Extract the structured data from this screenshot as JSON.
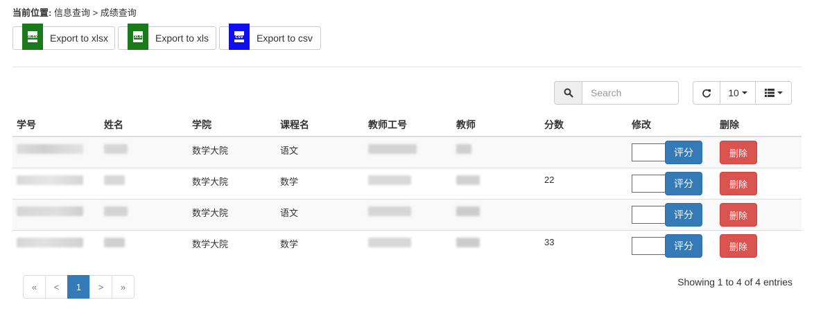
{
  "breadcrumb": {
    "label": "当前位置:",
    "path": "信息查询 > 成绩查询"
  },
  "export": [
    {
      "label": "Export to xlsx",
      "icon": "xlsx-file-icon",
      "badge": "XLSX",
      "color": "#1a7a1a"
    },
    {
      "label": "Export to xls",
      "icon": "xls-file-icon",
      "badge": "XLS",
      "color": "#1a7a1a"
    },
    {
      "label": "Export to csv",
      "icon": "csv-file-icon",
      "badge": "CSV",
      "color": "#1010ee"
    }
  ],
  "search": {
    "placeholder": "Search",
    "icon": "search-icon"
  },
  "toolbar": {
    "refresh_icon": "refresh-icon",
    "page_size": "10",
    "columns_icon": "list-icon"
  },
  "table": {
    "headers": [
      "学号",
      "姓名",
      "学院",
      "课程名",
      "教师工号",
      "教师",
      "分数",
      "修改",
      "删除"
    ],
    "rows": [
      {
        "college": "数学大院",
        "course": "语文",
        "score": "",
        "rate": "评分",
        "delete": "删除"
      },
      {
        "college": "数学大院",
        "course": "数学",
        "score": "22",
        "rate": "评分",
        "delete": "删除"
      },
      {
        "college": "数学大院",
        "course": "语文",
        "score": "",
        "rate": "评分",
        "delete": "删除"
      },
      {
        "college": "数学大院",
        "course": "数学",
        "score": "33",
        "rate": "评分",
        "delete": "删除"
      }
    ]
  },
  "pagination": {
    "first": "«",
    "prev": "<",
    "current": "1",
    "next": ">",
    "last": "»"
  },
  "summary": "Showing 1 to 4 of 4 entries",
  "colors": {
    "primary": "#337ab7",
    "danger": "#d9534f"
  }
}
